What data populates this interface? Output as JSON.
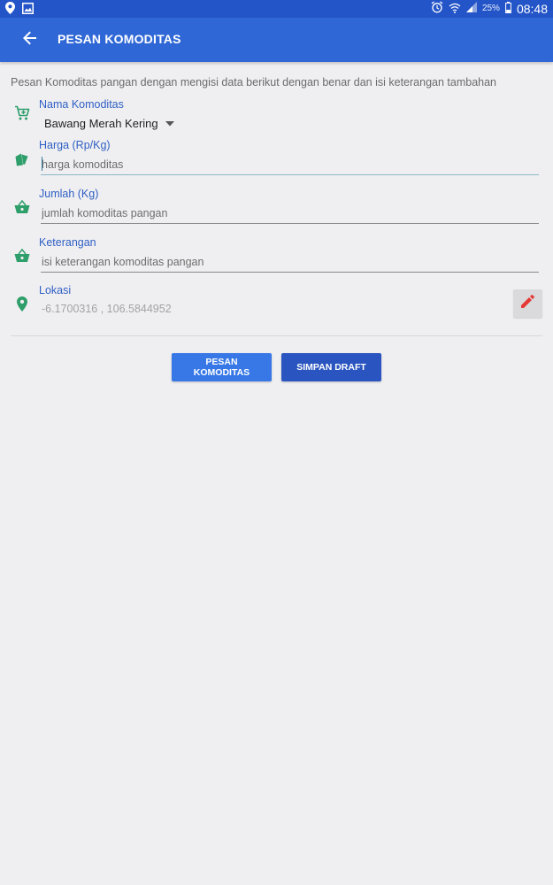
{
  "status_bar": {
    "battery": "25%",
    "time": "08:48"
  },
  "app_bar": {
    "title": "PESAN KOMODITAS"
  },
  "intro_text": "Pesan Komoditas pangan dengan mengisi data berikut dengan benar dan isi keterangan tambahan",
  "fields": {
    "nama": {
      "label": "Nama Komoditas",
      "value": "Bawang Merah Kering"
    },
    "harga": {
      "label": "Harga (Rp/Kg)",
      "placeholder": "harga komoditas"
    },
    "jumlah": {
      "label": "Jumlah (Kg)",
      "placeholder": "jumlah komoditas pangan"
    },
    "keterangan": {
      "label": "Keterangan",
      "placeholder": "isi keterangan komoditas pangan"
    },
    "lokasi": {
      "label": "Lokasi",
      "value": "-6.1700316 , 106.5844952"
    }
  },
  "buttons": {
    "pesan": "PESAN KOMODITAS",
    "draft": "SIMPAN DRAFT"
  },
  "colors": {
    "status_bar": "#2455c8",
    "app_bar": "#2f67d6",
    "label_blue": "#2f5fc4",
    "icon_green": "#2e9e6a",
    "edit_red": "#e53935",
    "button_primary": "#3778e6",
    "button_secondary": "#2a55c0"
  }
}
